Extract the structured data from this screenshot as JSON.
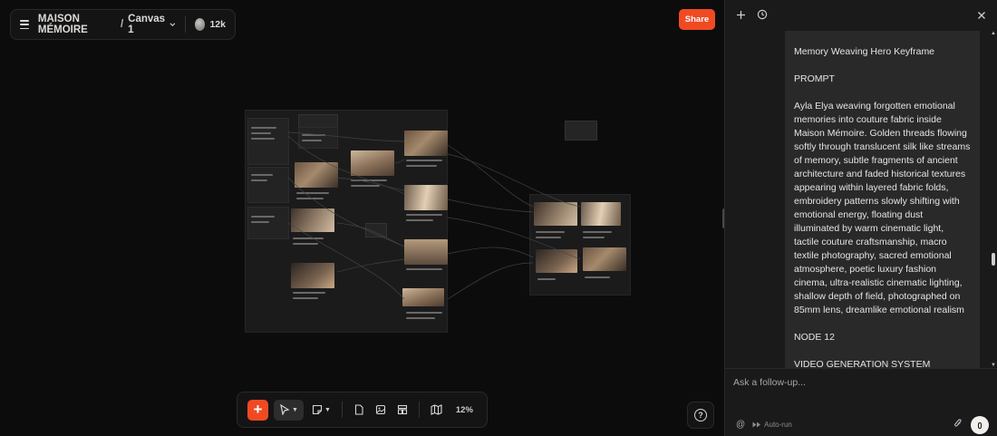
{
  "topbar": {
    "project": "MAISON MÉMOIRE",
    "separator": "/",
    "canvas_name": "Canvas 1",
    "credits": "12k"
  },
  "share": {
    "label": "Share"
  },
  "toolbar": {
    "add_label": "+",
    "zoom": "12%"
  },
  "help": {
    "label": "?"
  },
  "panel": {
    "message": [
      "Memory Weaving Hero Keyframe",
      "PROMPT",
      "Ayla Elya weaving forgotten emotional memories into couture fabric inside Maison Mémoire. Golden threads flowing softly through translucent silk like streams of memory, subtle fragments of ancient architecture and faded historical textures appearing within layered fabric folds, embroidery patterns slowly shifting with emotional energy, floating dust illuminated by warm cinematic light, tactile couture craftsmanship, macro textile photography, sacred emotional atmosphere, poetic luxury fashion cinema, ultra-realistic cinematic lighting, shallow depth of field, photographed on 85mm lens, dreamlike emotional realism",
      "NODE 12",
      "VIDEO GENERATION SYSTEM"
    ]
  },
  "composer": {
    "placeholder": "Ask a follow-up...",
    "mention": "@",
    "autorun": "Auto-run"
  },
  "colors": {
    "accent": "#f04a23",
    "canvas_bg": "#0d0c0d",
    "panel_bg": "#1b1a1b"
  },
  "icons": {
    "menu": "hamburger-icon",
    "avatar": "avatar",
    "new_chat": "plus-icon",
    "history": "history-icon",
    "close": "close-icon",
    "select": "pointer-icon",
    "sticky": "sticky-note-icon",
    "document": "document-icon",
    "image": "image-icon",
    "layout": "layout-icon",
    "map": "map-icon",
    "attach": "paperclip-icon",
    "mic": "microphone-icon"
  }
}
